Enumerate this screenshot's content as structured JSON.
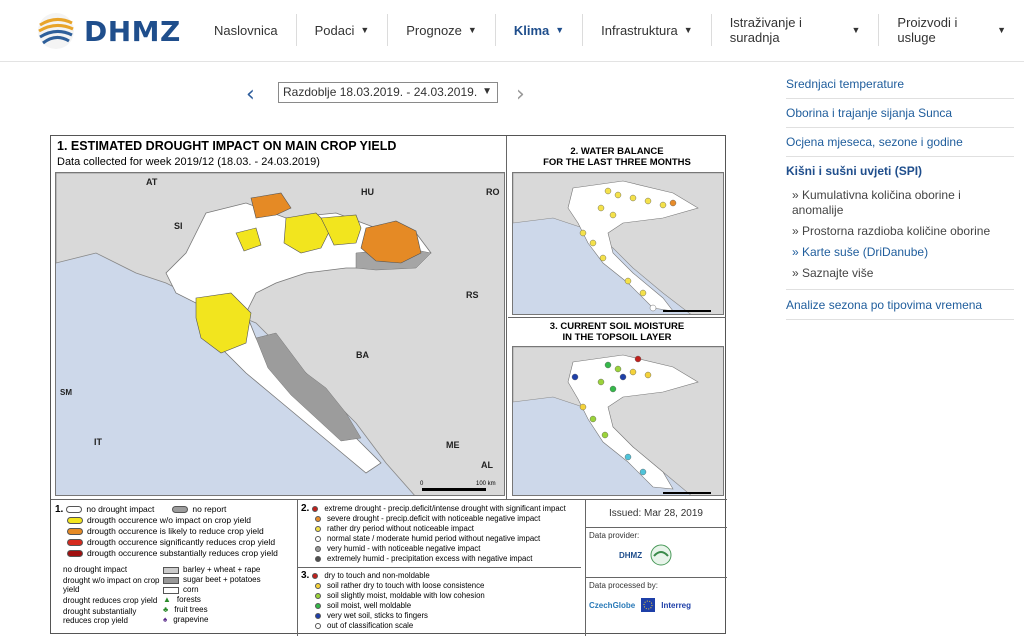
{
  "brand": {
    "name": "DHMZ"
  },
  "nav": {
    "items": [
      {
        "label": "Naslovnica",
        "dropdown": false,
        "active": false
      },
      {
        "label": "Podaci",
        "dropdown": true,
        "active": false
      },
      {
        "label": "Prognoze",
        "dropdown": true,
        "active": false
      },
      {
        "label": "Klima",
        "dropdown": true,
        "active": true
      },
      {
        "label": "Infrastruktura",
        "dropdown": true,
        "active": false
      },
      {
        "label": "Istraživanje i suradnja",
        "dropdown": true,
        "active": false
      },
      {
        "label": "Proizvodi i usluge",
        "dropdown": true,
        "active": false
      }
    ]
  },
  "period": {
    "selected": "Razdoblje 18.03.2019. - 24.03.2019."
  },
  "sidebar": {
    "items": [
      {
        "label": "Srednjaci temperature"
      },
      {
        "label": "Oborina i trajanje sijanja Sunca"
      },
      {
        "label": "Ocjena mjeseca, sezone i godine"
      },
      {
        "label": "Kišni i sušni uvjeti (SPI)"
      }
    ],
    "subitems": [
      {
        "label": "» Kumulativna količina oborine i anomalije"
      },
      {
        "label": "» Prostorna razdioba količine oborine"
      },
      {
        "label": "» Karte suše (DriDanube)"
      },
      {
        "label": "» Saznajte više"
      }
    ],
    "last": {
      "label": "Analize sezona po tipovima vremena"
    }
  },
  "poster": {
    "title1": "1. ESTIMATED DROUGHT IMPACT ON MAIN CROP YIELD",
    "subtitle1": "Data collected for week 2019/12 (18.03. - 24.03.2019)",
    "title2a": "2. WATER BALANCE",
    "title2b": "FOR THE LAST THREE MONTHS",
    "title3a": "3. CURRENT SOIL MOISTURE",
    "title3b": "IN THE TOPSOIL LAYER",
    "country_labels": [
      "AT",
      "HU",
      "RO",
      "SI",
      "RS",
      "BA",
      "IT",
      "ME",
      "AL",
      "SM"
    ],
    "scale_label": "100 km",
    "scale_zero": "0",
    "legend1": [
      {
        "text": "no drought impact",
        "color": "#ffffff"
      },
      {
        "text": "drougth occurence w/o impact on crop yield",
        "color": "#f2e51e"
      },
      {
        "text": "drougth occurence is likely to reduce crop yield",
        "color": "#e58a25"
      },
      {
        "text": "drougth occurence significantly reduces crop yield",
        "color": "#d62a1e"
      },
      {
        "text": "drougth occurence substantially reduces crop yield",
        "color": "#a01010"
      }
    ],
    "no_report": "no report",
    "legend_symbols": [
      "no drought impact",
      "drought w/o impact on crop yield",
      "drought reduces crop yield",
      "drought substantially reduces crop yield"
    ],
    "legend_crops": [
      "barley + wheat + rape",
      "sugar beet + potatoes",
      "corn",
      "forests",
      "fruit trees",
      "grapevine"
    ],
    "legend2": [
      {
        "text": "extreme drought - precip.deficit/intense drought with significant impact",
        "color": "#c0201c"
      },
      {
        "text": "severe drought - precip.deficit with noticeable negative impact",
        "color": "#e88c2a"
      },
      {
        "text": "rather dry period without noticeable impact",
        "color": "#f4e14a"
      },
      {
        "text": "normal state / moderate humid period without negative impact",
        "color": "#ffffff"
      },
      {
        "text": "very humid - with noticeable negative impact",
        "color": "#9a9a9a"
      },
      {
        "text": "extremely humid - precipitation excess with negative impact",
        "color": "#505050"
      }
    ],
    "legend3": [
      {
        "text": "dry to touch and non-moldable",
        "color": "#c0201c"
      },
      {
        "text": "soil rather dry to touch with loose consistence",
        "color": "#f4d23a"
      },
      {
        "text": "soil slightly moist, moldable with low cohesion",
        "color": "#9bd33a"
      },
      {
        "text": "soil moist, well moldable",
        "color": "#35b84a"
      },
      {
        "text": "very wet soil, sticks to fingers",
        "color": "#1e3fa8"
      },
      {
        "text": "out of classification scale",
        "color": "#ffffff"
      }
    ],
    "issued": "Issued: Mar 28, 2019",
    "data_provider": "Data provider:",
    "data_processed": "Data processed by:",
    "logo_dhmz": "DHMZ",
    "logo_czechglobe": "CzechGlobe",
    "logo_interreg": "Interreg"
  }
}
